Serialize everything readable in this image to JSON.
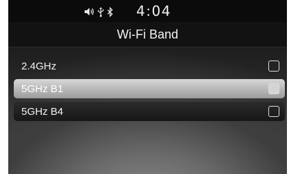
{
  "status_bar": {
    "time": "4:04",
    "icons": [
      "volume-icon",
      "usb-icon",
      "bluetooth-icon"
    ]
  },
  "header": {
    "title": "Wi-Fi Band"
  },
  "options": [
    {
      "label": "2.4GHz",
      "state": "normal"
    },
    {
      "label": "5GHz B1",
      "state": "highlighted"
    },
    {
      "label": "5GHz B4",
      "state": "normal"
    }
  ],
  "colors": {
    "background_top": "#1a1a1a",
    "highlight": "#c4c4c4",
    "text": "#f2f2f2"
  }
}
